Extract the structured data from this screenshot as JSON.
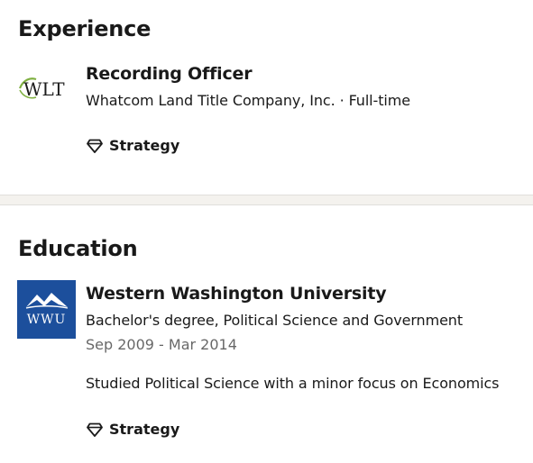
{
  "experience": {
    "heading": "Experience",
    "entries": [
      {
        "logo_text": "WLT",
        "title": "Recording Officer",
        "subtitle": "Whatcom Land Title Company, Inc. · Full-time",
        "skill": "Strategy",
        "skill_icon": "diamond-icon"
      }
    ]
  },
  "education": {
    "heading": "Education",
    "entries": [
      {
        "logo_text": "WWU",
        "logo_color": "#1c4f9c",
        "school": "Western Washington University",
        "degree": "Bachelor's degree, Political Science and Government",
        "dates": "Sep 2009 - Mar 2014",
        "description": "Studied Political Science with a minor focus on Economics",
        "skill": "Strategy",
        "skill_icon": "diamond-icon"
      }
    ]
  }
}
